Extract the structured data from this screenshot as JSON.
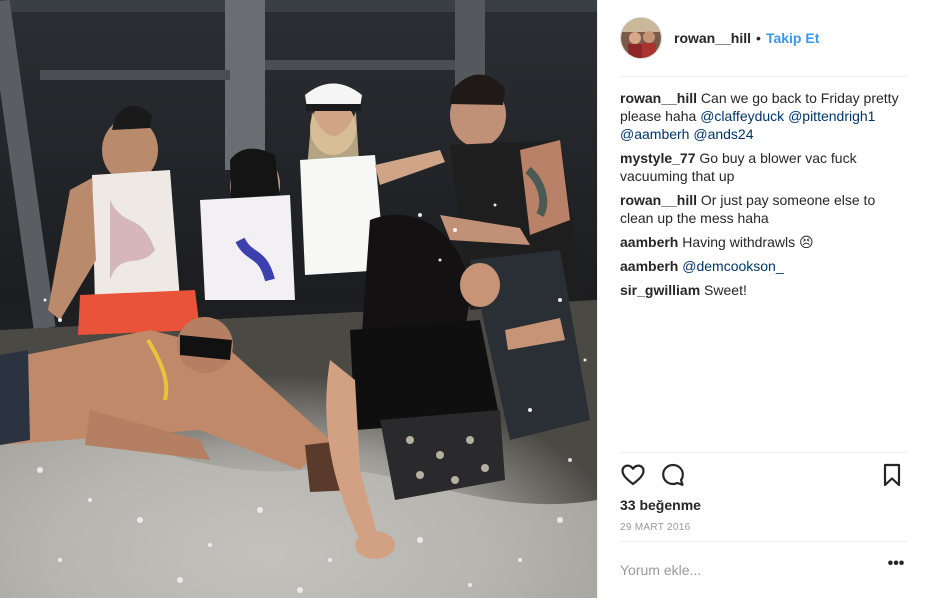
{
  "header": {
    "username": "rowan__hill",
    "separator": "•",
    "follow_label": "Takip Et"
  },
  "comments": [
    {
      "user": "rowan__hill",
      "parts": [
        {
          "t": "text",
          "v": " Can we go back to Friday pretty please haha "
        },
        {
          "t": "mention",
          "v": "@claffeyduck"
        },
        {
          "t": "text",
          "v": " "
        },
        {
          "t": "mention",
          "v": "@pittendrigh1"
        },
        {
          "t": "text",
          "v": " "
        },
        {
          "t": "mention",
          "v": "@aamberh"
        },
        {
          "t": "text",
          "v": " "
        },
        {
          "t": "mention",
          "v": "@ands24"
        }
      ]
    },
    {
      "user": "mystyle_77",
      "parts": [
        {
          "t": "text",
          "v": " Go buy a blower vac fuck vacuuming that up"
        }
      ]
    },
    {
      "user": "rowan__hill",
      "parts": [
        {
          "t": "text",
          "v": " Or just pay someone else to clean up the mess haha"
        }
      ]
    },
    {
      "user": "aamberh",
      "parts": [
        {
          "t": "text",
          "v": " Having withdrawls "
        },
        {
          "t": "emoji",
          "v": "😣"
        }
      ]
    },
    {
      "user": "aamberh",
      "parts": [
        {
          "t": "text",
          "v": " "
        },
        {
          "t": "mention",
          "v": "@demcookson_"
        }
      ]
    },
    {
      "user": "sir_gwilliam",
      "parts": [
        {
          "t": "text",
          "v": " Sweet!"
        }
      ]
    }
  ],
  "actions": {
    "like_icon": "heart-outline-icon",
    "comment_icon": "speech-bubble-icon",
    "save_icon": "bookmark-icon"
  },
  "likes": "33 beğenme",
  "date": "29 MART 2016",
  "add_comment": {
    "placeholder": "Yorum ekle...",
    "value": ""
  },
  "more_label": "•••",
  "colors": {
    "link": "#3897f0",
    "mention": "#003569",
    "text": "#262626",
    "muted": "#999999",
    "divider": "#efefef"
  }
}
